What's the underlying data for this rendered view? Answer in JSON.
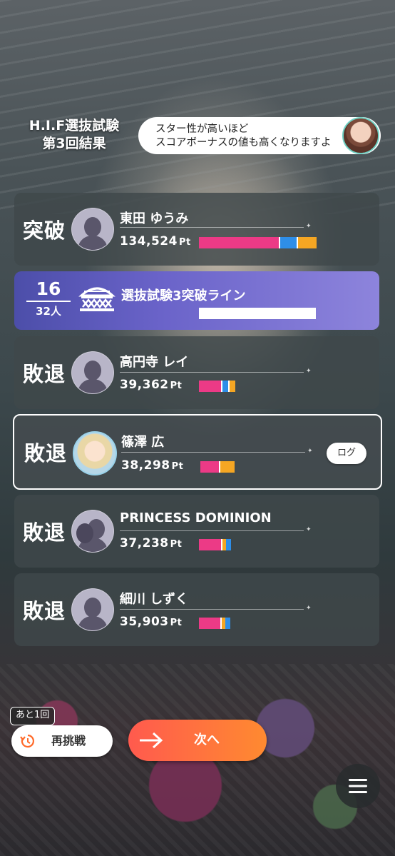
{
  "header": {
    "title_line1": "H.I.F選抜試験",
    "title_line2": "第3回結果"
  },
  "tip": {
    "line1": "スター性が高いほど",
    "line2": "スコアボーナスの値も高くなりますよ"
  },
  "ranking": [
    {
      "status": "突破",
      "name": "東田 ゆうみ",
      "points": "134,524",
      "unit": "Pt",
      "bar": [
        {
          "color": "pink",
          "fraction": 0.68
        },
        {
          "color": "white",
          "fraction": 0.01
        },
        {
          "color": "blue",
          "fraction": 0.14
        },
        {
          "color": "white",
          "fraction": 0.01
        },
        {
          "color": "orange",
          "fraction": 0.16
        }
      ]
    },
    {
      "status": "敗退",
      "name": "高円寺 レイ",
      "points": "39,362",
      "unit": "Pt",
      "bar": [
        {
          "color": "pink",
          "fraction": 0.19
        },
        {
          "color": "white",
          "fraction": 0.01
        },
        {
          "color": "blue",
          "fraction": 0.05
        },
        {
          "color": "white",
          "fraction": 0.01
        },
        {
          "color": "orange",
          "fraction": 0.05
        }
      ]
    },
    {
      "status": "敗退",
      "name": "篠澤 広",
      "points": "38,298",
      "unit": "Pt",
      "button": "ログ",
      "bar": [
        {
          "color": "pink",
          "fraction": 0.16
        },
        {
          "color": "white",
          "fraction": 0.01
        },
        {
          "color": "orange",
          "fraction": 0.12
        }
      ]
    },
    {
      "status": "敗退",
      "name": "PRINCESS DOMINION",
      "points": "37,238",
      "unit": "Pt",
      "bar": [
        {
          "color": "pink",
          "fraction": 0.19
        },
        {
          "color": "white",
          "fraction": 0.01
        },
        {
          "color": "orange",
          "fraction": 0.03
        },
        {
          "color": "blue",
          "fraction": 0.04
        }
      ]
    },
    {
      "status": "敗退",
      "name": "細川 しずく",
      "points": "35,903",
      "unit": "Pt",
      "bar": [
        {
          "color": "pink",
          "fraction": 0.18
        },
        {
          "color": "white",
          "fraction": 0.01
        },
        {
          "color": "orange",
          "fraction": 0.03
        },
        {
          "color": "blue",
          "fraction": 0.04
        }
      ]
    }
  ],
  "cutoff": {
    "rank": "16",
    "total": "32人",
    "label": "選抜試験3突破ライン",
    "bar_fill": 1.0
  },
  "controls": {
    "remaining_badge": "あと1回",
    "retry_label": "再挑戦",
    "next_label": "次へ"
  },
  "colors": {
    "pink": "#ec3a86",
    "blue": "#2e8ee8",
    "orange": "#f5a623",
    "white": "#ffffff",
    "next_gradient_start": "#ff5a4e",
    "next_gradient_end": "#ff8a30",
    "cutoff_bg": "#6a63c9"
  },
  "icons": {
    "retry": "retry-clock-icon",
    "next": "arrow-right-icon",
    "menu": "hamburger-menu-icon",
    "cutoff": "stage-gate-icon"
  }
}
